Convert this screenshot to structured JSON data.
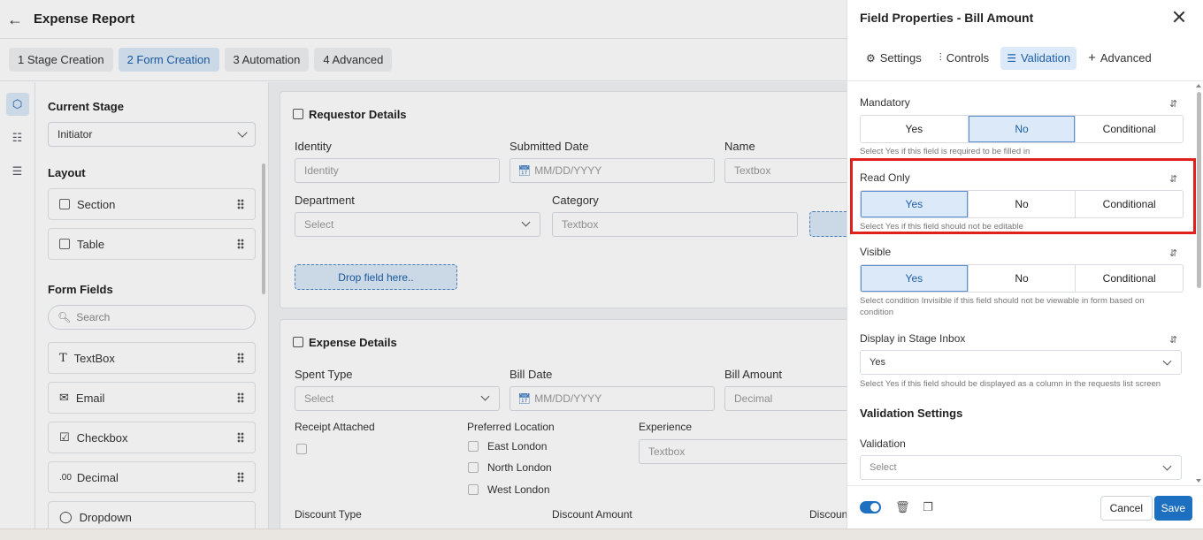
{
  "app": {
    "title": "Expense Report",
    "steps": [
      {
        "label": "1  Stage Creation"
      },
      {
        "label": "2  Form Creation"
      },
      {
        "label": "3  Automation"
      },
      {
        "label": "4  Advanced"
      }
    ]
  },
  "left_panel": {
    "current_stage_title": "Current Stage",
    "current_stage_value": "Initiator",
    "layout_title": "Layout",
    "layout_items": [
      {
        "label": "Section"
      },
      {
        "label": "Table"
      }
    ],
    "form_fields_title": "Form Fields",
    "search_placeholder": "Search",
    "fields": [
      {
        "label": "TextBox"
      },
      {
        "label": "Email"
      },
      {
        "label": "Checkbox"
      },
      {
        "label": "Decimal"
      },
      {
        "label": "Dropdown"
      }
    ]
  },
  "canvas": {
    "requestor": {
      "title": "Requestor Details",
      "identity_label": "Identity",
      "identity_ph": "Identity",
      "submitted_label": "Submitted Date",
      "submitted_ph": "MM/DD/YYYY",
      "name_label": "Name",
      "name_ph": "Textbox",
      "department_label": "Department",
      "department_ph": "Select",
      "category_label": "Category",
      "category_ph": "Textbox",
      "drop_label": "Drop field here.."
    },
    "expense": {
      "title": "Expense Details",
      "spent_label": "Spent Type",
      "spent_ph": "Select",
      "billdate_label": "Bill Date",
      "billdate_ph": "MM/DD/YYYY",
      "billamt_label": "Bill Amount",
      "billamt_ph": "Decimal",
      "receipt_label": "Receipt Attached",
      "location_label": "Preferred Location",
      "locations": [
        "East London",
        "North London",
        "West London"
      ],
      "experience_label": "Experience",
      "experience_ph": "Textbox",
      "disc_type_label": "Discount Type",
      "disc_amt_label": "Discount Amount",
      "disc_label": "Discoun"
    }
  },
  "panel": {
    "title": "Field Properties - Bill Amount",
    "tabs": [
      {
        "label": "Settings"
      },
      {
        "label": "Controls"
      },
      {
        "label": "Validation"
      },
      {
        "label": "Advanced"
      }
    ],
    "mandatory": {
      "label": "Mandatory",
      "options": [
        "Yes",
        "No",
        "Conditional"
      ],
      "selected": "No",
      "hint": "Select Yes if this field is required to be filled in"
    },
    "read_only": {
      "label": "Read Only",
      "options": [
        "Yes",
        "No",
        "Conditional"
      ],
      "selected": "Yes",
      "hint": "Select Yes if this field should not be editable"
    },
    "visible": {
      "label": "Visible",
      "options": [
        "Yes",
        "No",
        "Conditional"
      ],
      "selected": "Yes",
      "hint": "Select condition Invisible if this field should not be viewable in form based on condition"
    },
    "display_inbox": {
      "label": "Display in Stage Inbox",
      "value": "Yes",
      "hint": "Select Yes if this field should be displayed as a column in the requests list screen"
    },
    "validation_settings_title": "Validation Settings",
    "validation": {
      "label": "Validation",
      "placeholder": "Select"
    },
    "cancel_label": "Cancel",
    "save_label": "Save"
  },
  "colors": {
    "accent": "#1d6fc0",
    "highlight": "#e0201c",
    "selected_bg": "#dbe9f8"
  }
}
